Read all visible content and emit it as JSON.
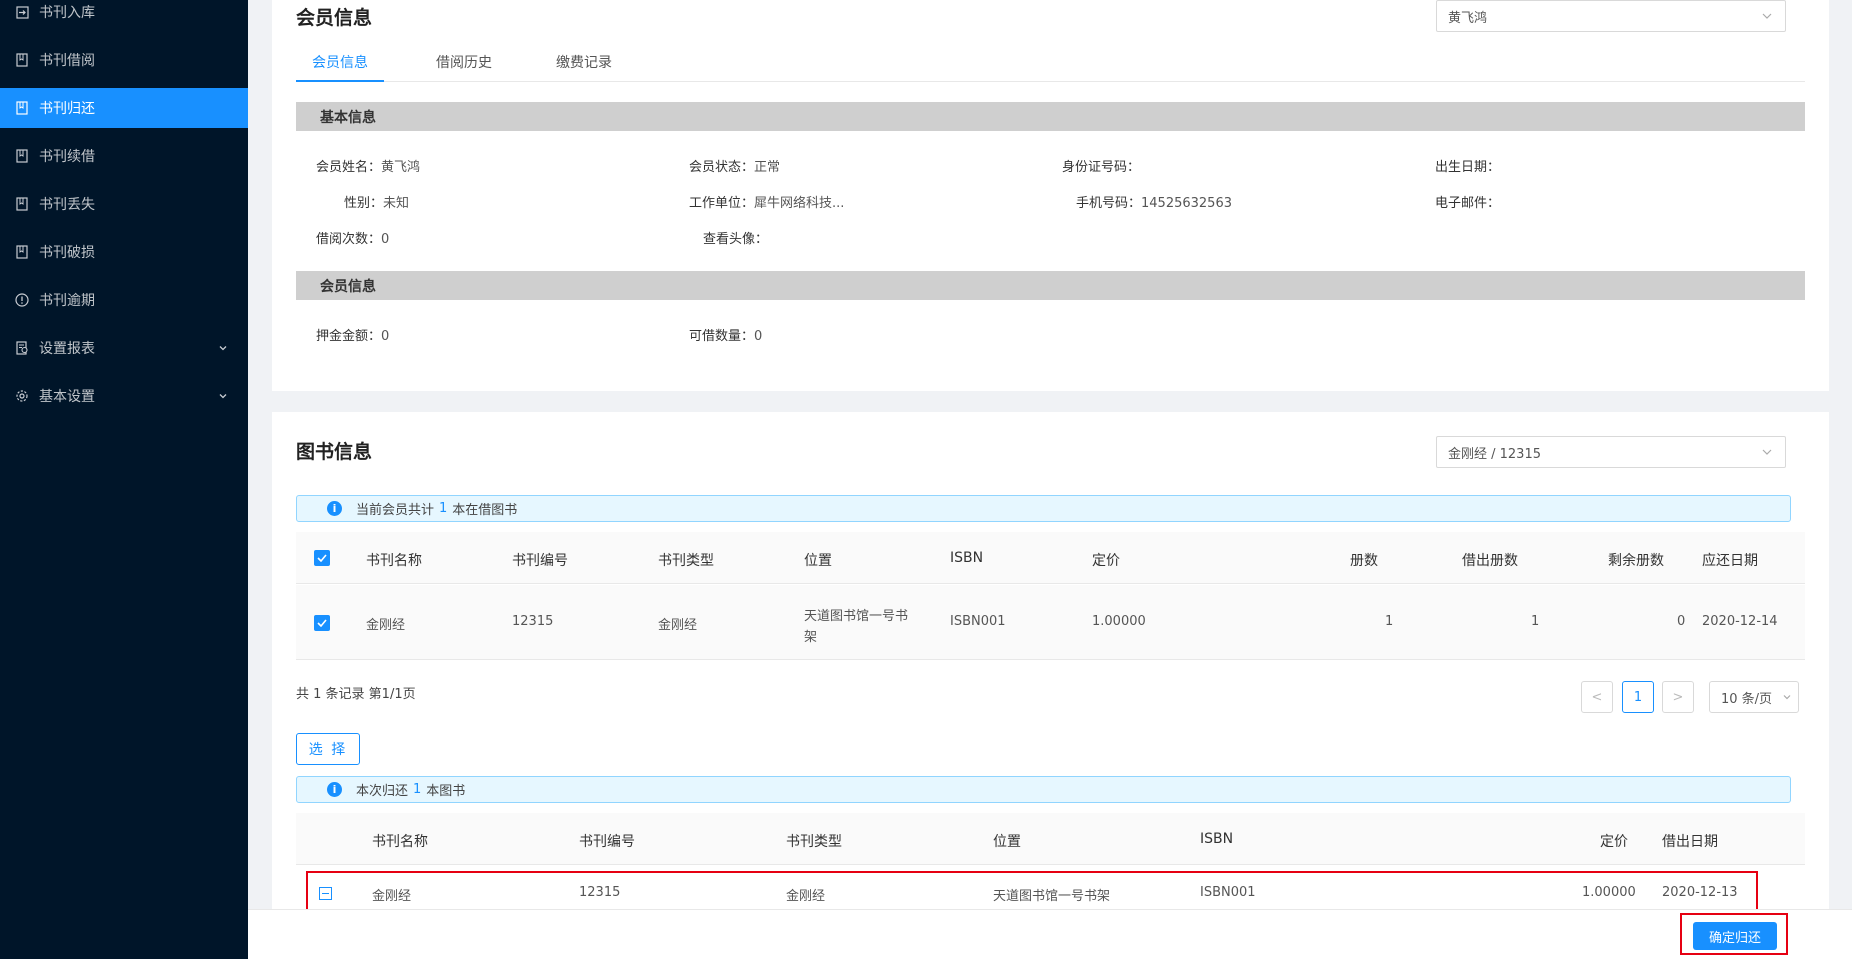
{
  "sidebar": {
    "items": [
      {
        "label": "书刊入库",
        "icon": "import-icon"
      },
      {
        "label": "书刊借阅",
        "icon": "book-icon"
      },
      {
        "label": "书刊归还",
        "icon": "book-icon",
        "active": true
      },
      {
        "label": "书刊续借",
        "icon": "book-icon"
      },
      {
        "label": "书刊丢失",
        "icon": "book-icon"
      },
      {
        "label": "书刊破损",
        "icon": "book-icon"
      },
      {
        "label": "书刊逾期",
        "icon": "exclamation-circle-icon"
      },
      {
        "label": "设置报表",
        "icon": "report-icon",
        "expandable": true
      },
      {
        "label": "基本设置",
        "icon": "gear-icon",
        "expandable": true
      }
    ]
  },
  "member_card": {
    "title": "会员信息",
    "member_select_value": "黄飞鸿",
    "tabs": [
      "会员信息",
      "借阅历史",
      "缴费记录"
    ],
    "basic_section_title": "基本信息",
    "basic_fields": {
      "name": {
        "label": "会员姓名：",
        "value": "黄飞鸿"
      },
      "status": {
        "label": "会员状态：",
        "value": "正常"
      },
      "id_number": {
        "label": "身份证号码：",
        "value": ""
      },
      "birth_date": {
        "label": "出生日期：",
        "value": ""
      },
      "gender": {
        "label": "性别：",
        "value": "未知"
      },
      "work_unit": {
        "label": "工作单位：",
        "value": "犀牛网络科技..."
      },
      "phone": {
        "label": "手机号码：",
        "value": "14525632563"
      },
      "email": {
        "label": "电子邮件：",
        "value": ""
      },
      "borrow_count": {
        "label": "借阅次数：",
        "value": "0"
      },
      "avatar": {
        "label": "查看头像：",
        "value": ""
      }
    },
    "member_section_title": "会员信息",
    "member_fields": {
      "deposit": {
        "label": "押金金额：",
        "value": "0"
      },
      "borrowable": {
        "label": "可借数量：",
        "value": "0"
      }
    }
  },
  "book_card": {
    "title": "图书信息",
    "book_select_value": "金刚经 / 12315",
    "alert1": {
      "prefix": "当前会员共计",
      "count": "1",
      "suffix": "本在借图书"
    },
    "table1": {
      "headers": [
        "书刊名称",
        "书刊编号",
        "书刊类型",
        "位置",
        "ISBN",
        "定价",
        "册数",
        "借出册数",
        "剩余册数",
        "应还日期"
      ],
      "rows": [
        {
          "name": "金刚经",
          "code": "12315",
          "type": "金刚经",
          "location_line1": "天道图书馆一号书",
          "location_line2": "架",
          "isbn": "ISBN001",
          "price": "1.00000",
          "copies": "1",
          "lent": "1",
          "remaining": "0",
          "due_date": "2020-12-14"
        }
      ]
    },
    "pagination": {
      "summary": "共 1 条记录 第1/1页",
      "current_page": "1",
      "page_size": "10 条/页",
      "prev": "<",
      "next": ">"
    },
    "select_button": "选 择",
    "alert2": {
      "prefix": "本次归还",
      "count": "1",
      "suffix": "本图书"
    },
    "table2": {
      "headers": [
        "书刊名称",
        "书刊编号",
        "书刊类型",
        "位置",
        "ISBN",
        "定价",
        "借出日期"
      ],
      "rows": [
        {
          "name": "金刚经",
          "code": "12315",
          "type": "金刚经",
          "location": "天道图书馆一号书架",
          "isbn": "ISBN001",
          "price": "1.00000",
          "lend_date": "2020-12-13"
        }
      ]
    }
  },
  "footer": {
    "confirm_button": "确定归还"
  },
  "colors": {
    "primary": "#1890ff",
    "sidebar_bg": "#001529",
    "highlight_border": "#e60012"
  }
}
